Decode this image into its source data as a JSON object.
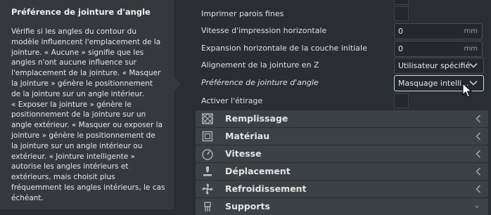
{
  "tooltip": {
    "title": "Préférence de jointure d'angle",
    "lines": [
      "Vérifie si les angles du contour du",
      "modèle influencent l'emplacement de la",
      "jointure. « Aucune » signifie que les",
      "angles n'ont aucune influence sur",
      "l'emplacement de la jointure. « Masquer",
      "la jointure » génère le positionnement",
      "de la jointure sur un angle intérieur.",
      "« Exposer la jointure » génère le",
      "positionnement de la jointure sur un",
      "angle extérieur. « Masquer ou exposer la",
      "jointure » génère le positionnement de",
      "la jointure sur un angle intérieur ou",
      "extérieur. « Jointure intelligente »",
      "autorise les angles intérieurs et",
      "extérieurs, mais choisit plus",
      "fréquemment les angles intérieurs, le cas",
      "échéant."
    ]
  },
  "settings": {
    "print_thin_walls": {
      "label": "Imprimer parois fines"
    },
    "horizontal_print_speed": {
      "label": "Vitesse d'impression horizontale",
      "value": "0",
      "unit": "mm"
    },
    "initial_layer_horizontal_expansion": {
      "label": "Expansion horizontale de la couche initiale",
      "value": "0",
      "unit": "mm"
    },
    "z_seam_alignment": {
      "label": "Alignement de la jointure en Z",
      "value": "Utilisateur spécifié"
    },
    "seam_corner_preference": {
      "label": "Préférence de jointure d'angle",
      "value": "Masquage intelli..."
    },
    "enable_stretching": {
      "label": "Activer l'étirage"
    }
  },
  "categories": [
    {
      "label": "Remplissage",
      "icon": "infill-icon"
    },
    {
      "label": "Matériau",
      "icon": "material-icon"
    },
    {
      "label": "Vitesse",
      "icon": "speed-icon"
    },
    {
      "label": "Déplacement",
      "icon": "travel-icon"
    },
    {
      "label": "Refroidissement",
      "icon": "cooling-icon"
    },
    {
      "label": "Supports",
      "icon": "support-icon"
    }
  ],
  "colors": {
    "background": "#2a2e32",
    "tooltip_background": "#35393e",
    "category_background": "#3c4146",
    "active_dropdown_border": "#c7d8f0"
  }
}
